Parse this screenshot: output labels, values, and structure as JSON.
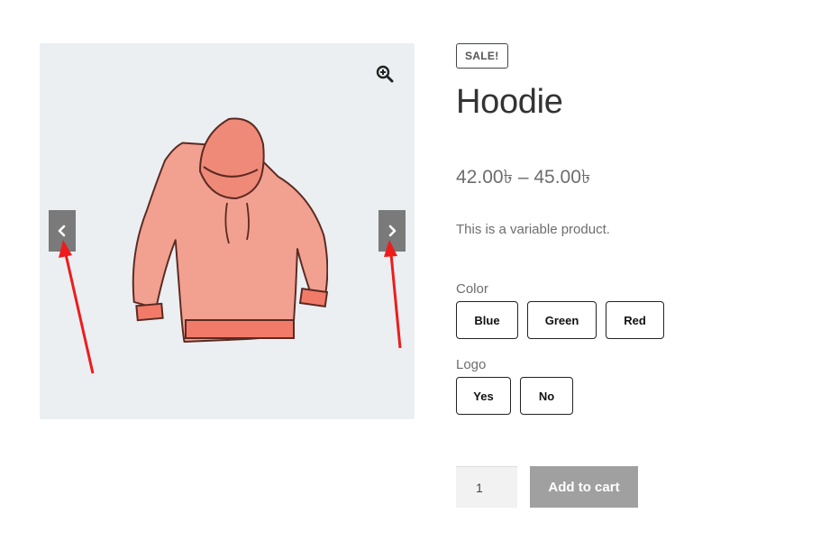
{
  "gallery": {
    "zoom_icon": "magnifier-plus-icon",
    "image_icon": "hoodie-image",
    "prev_icon": "chevron-left-icon",
    "next_icon": "chevron-right-icon"
  },
  "product": {
    "badge": "SALE!",
    "title": "Hoodie",
    "price": "42.00৳ – 45.00৳",
    "description": "This is a variable product."
  },
  "attributes": {
    "color": {
      "label": "Color",
      "options": [
        "Blue",
        "Green",
        "Red"
      ]
    },
    "logo": {
      "label": "Logo",
      "options": [
        "Yes",
        "No"
      ]
    }
  },
  "cart": {
    "quantity": "1",
    "button_label": "Add to cart"
  },
  "colors": {
    "accent_arrow": "#ee1c1c",
    "gallery_bg": "#ebeff2",
    "hoodie": "#f2a090",
    "button_bg": "#a0a0a0"
  }
}
